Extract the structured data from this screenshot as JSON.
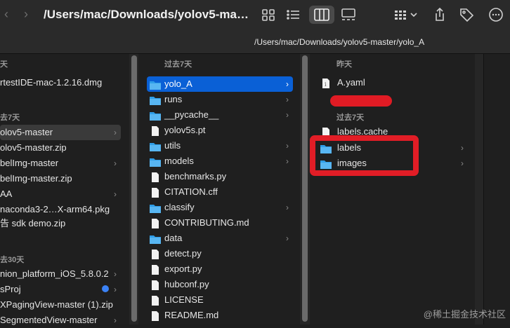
{
  "toolbar": {
    "title": "/Users/mac/Downloads/yolov5-master/yolo_A"
  },
  "pathbar": {
    "path": "/Users/mac/Downloads/yolov5-master/yolo_A"
  },
  "col1": {
    "sections": [
      "天",
      "去7天",
      "去30天"
    ],
    "items": [
      {
        "label": "rtestIDE-mac-1.2.16.dmg"
      },
      {
        "label": "olov5-master"
      },
      {
        "label": "olov5-master.zip"
      },
      {
        "label": "belImg-master"
      },
      {
        "label": "belImg-master.zip"
      },
      {
        "label": "AA"
      },
      {
        "label": "naconda3-2…X-arm64.pkg"
      },
      {
        "label": "告 sdk demo.zip"
      },
      {
        "label": "nion_platform_iOS_5.8.0.2"
      },
      {
        "label": "sProj"
      },
      {
        "label": "XPagingView-master (1).zip"
      },
      {
        "label": "SegmentedView-master"
      }
    ]
  },
  "col2": {
    "section": "过去7天",
    "items": [
      {
        "label": "yolo_A"
      },
      {
        "label": "runs"
      },
      {
        "label": "__pycache__"
      },
      {
        "label": "yolov5s.pt"
      },
      {
        "label": "utils"
      },
      {
        "label": "models"
      },
      {
        "label": "benchmarks.py"
      },
      {
        "label": "CITATION.cff"
      },
      {
        "label": "classify"
      },
      {
        "label": "CONTRIBUTING.md"
      },
      {
        "label": "data"
      },
      {
        "label": "detect.py"
      },
      {
        "label": "export.py"
      },
      {
        "label": "hubconf.py"
      },
      {
        "label": "LICENSE"
      },
      {
        "label": "README.md"
      }
    ]
  },
  "col3": {
    "section_today": "昨天",
    "section_week": "过去7天",
    "items": [
      {
        "label": "A.yaml"
      },
      {
        "label": "labels.cache"
      },
      {
        "label": "labels"
      },
      {
        "label": "images"
      }
    ]
  },
  "watermark": "@稀土掘金技术社区"
}
